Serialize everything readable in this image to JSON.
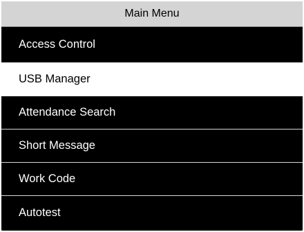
{
  "header": {
    "title": "Main Menu"
  },
  "menu": {
    "selected_index": 1,
    "items": [
      {
        "label": "Access Control"
      },
      {
        "label": "USB Manager"
      },
      {
        "label": "Attendance Search"
      },
      {
        "label": "Short Message"
      },
      {
        "label": "Work Code"
      },
      {
        "label": "Autotest"
      }
    ]
  },
  "colors": {
    "background": "#000000",
    "header": "#d4d4d4",
    "selected_background": "#ffffff",
    "text": "#ffffff"
  }
}
